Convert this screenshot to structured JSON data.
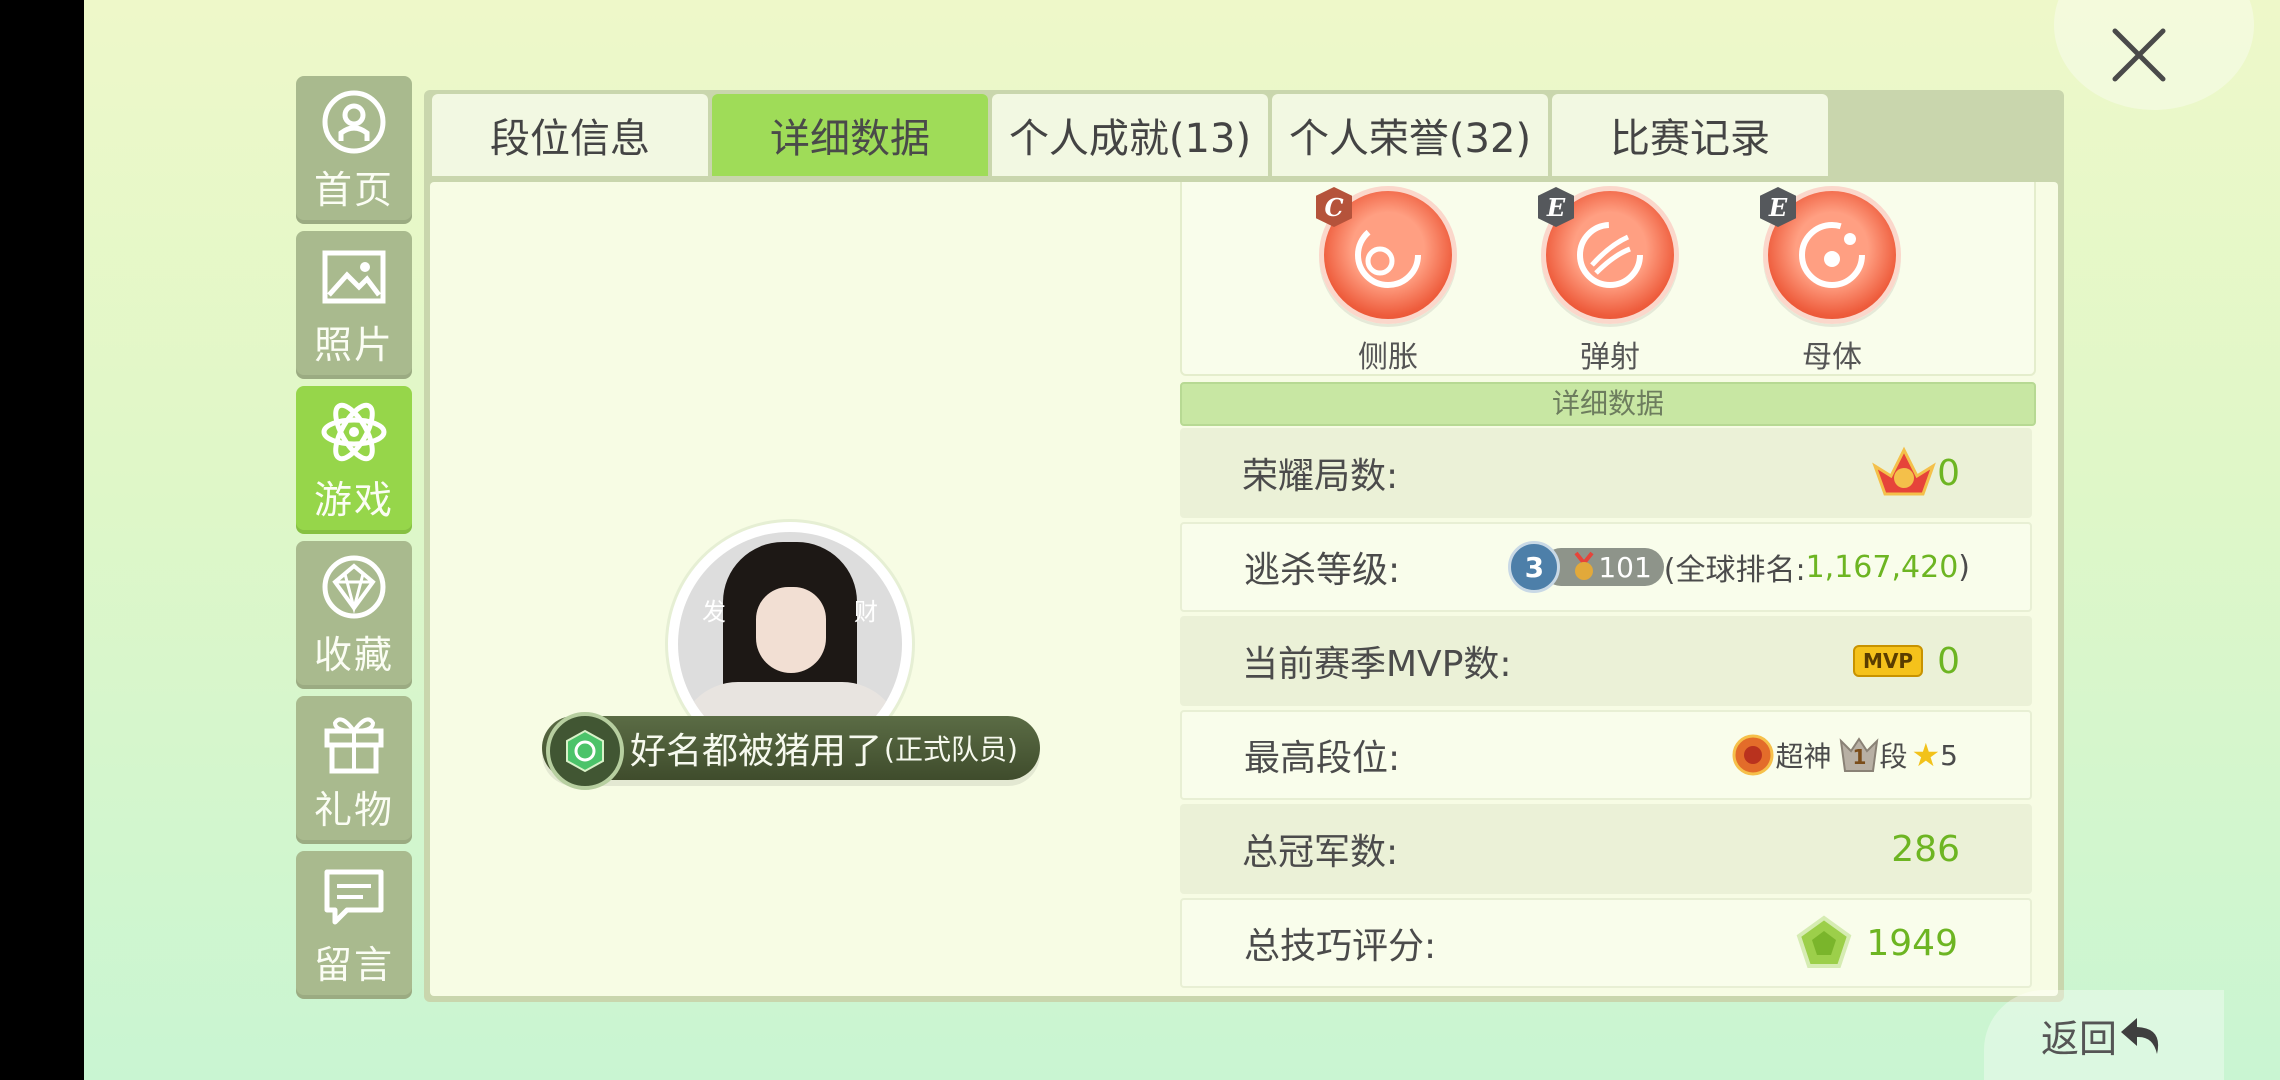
{
  "sidebar": {
    "items": [
      {
        "label": "首页",
        "icon": "home-icon"
      },
      {
        "label": "照片",
        "icon": "photo-icon"
      },
      {
        "label": "游戏",
        "icon": "atom-icon"
      },
      {
        "label": "收藏",
        "icon": "diamond-icon"
      },
      {
        "label": "礼物",
        "icon": "gift-icon"
      },
      {
        "label": "留言",
        "icon": "message-icon"
      }
    ],
    "active_index": 2
  },
  "tabs": [
    "段位信息",
    "详细数据",
    "个人成就(13)",
    "个人荣誉(32)",
    "比赛记录"
  ],
  "active_tab": 1,
  "profile": {
    "avatar_text_left": "发",
    "avatar_text_right": "财",
    "nickname": "好名都被猪用了",
    "role": "(正式队员)"
  },
  "skills": [
    {
      "name": "侧胀",
      "grade": "C"
    },
    {
      "name": "弹射",
      "grade": "E"
    },
    {
      "name": "母体",
      "grade": "E"
    }
  ],
  "section_title": "详细数据",
  "stats": {
    "glory_games": {
      "label": "荣耀局数:",
      "value": "0"
    },
    "escape_level": {
      "label": "逃杀等级:",
      "tier": "3",
      "level": "101",
      "rank_text": "(全球排名:",
      "rank_value": "1,167,420",
      "rank_close": ")"
    },
    "mvp_count": {
      "label": "当前赛季MVP数:",
      "badge": "MVP",
      "value": "0"
    },
    "highest_rank": {
      "label": "最高段位:",
      "rank_name": "超神",
      "seg_num": "1",
      "seg_label": "段",
      "stars": "5"
    },
    "champion_count": {
      "label": "总冠军数:",
      "value": "286"
    },
    "skill_score": {
      "label": "总技巧评分:",
      "value": "1949"
    }
  },
  "back_label": "返回",
  "colors": {
    "accent_green": "#96d64a",
    "value_green": "#6db522",
    "skill_orange": "#ee5c3c"
  }
}
